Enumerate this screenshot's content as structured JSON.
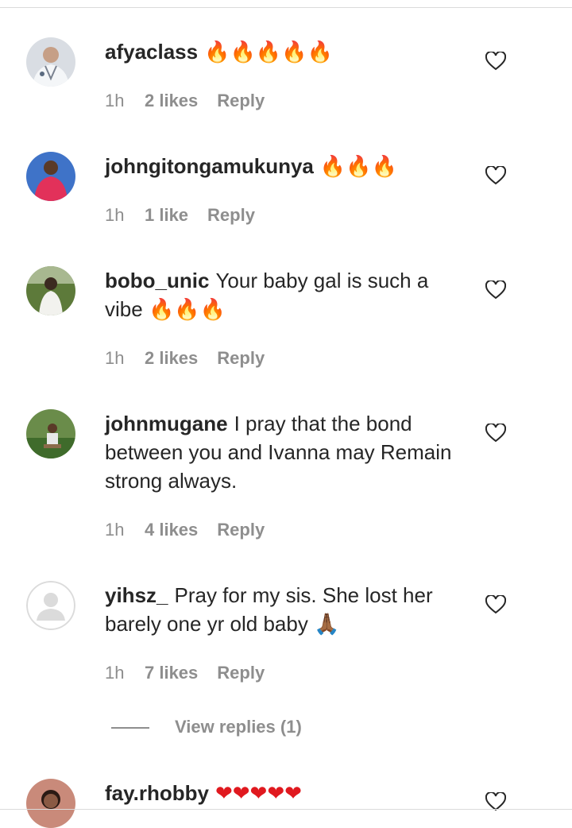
{
  "comments": [
    {
      "username": "afyaclass",
      "text": "",
      "emoji": "🔥🔥🔥🔥🔥",
      "time": "1h",
      "likes": "2 likes",
      "reply": "Reply",
      "avatar_icon": "avatar-doctor"
    },
    {
      "username": "johngitongamukunya",
      "text": "",
      "emoji": "🔥🔥🔥",
      "time": "1h",
      "likes": "1 like",
      "reply": "Reply",
      "avatar_icon": "avatar-person-red"
    },
    {
      "username": "bobo_unic",
      "text": "Your baby gal is such a vibe",
      "emoji": "🔥🔥🔥",
      "time": "1h",
      "likes": "2 likes",
      "reply": "Reply",
      "avatar_icon": "avatar-outdoor"
    },
    {
      "username": "johnmugane",
      "text": "I pray that the bond between you and Ivanna may Remain strong always.",
      "emoji": "",
      "time": "1h",
      "likes": "4 likes",
      "reply": "Reply",
      "avatar_icon": "avatar-garden"
    },
    {
      "username": "yihsz_",
      "text": "Pray for my sis. She lost her barely one yr old baby",
      "emoji": "🙏🏾",
      "time": "1h",
      "likes": "7 likes",
      "reply": "Reply",
      "avatar_icon": "avatar-default"
    },
    {
      "username": "fay.rhobby",
      "text": "",
      "emoji": "❤❤❤❤❤",
      "avatar_icon": "avatar-woman"
    }
  ],
  "view_replies": "View replies (1)",
  "colors": {
    "text": "#262626",
    "secondary": "#8e8e8e",
    "divider": "#dbdbdb",
    "fire": "#f77f00",
    "heart_red": "#e0191f"
  }
}
